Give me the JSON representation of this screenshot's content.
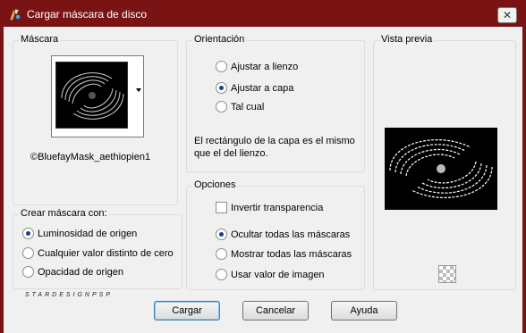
{
  "window": {
    "title": "Cargar máscara de disco",
    "close_glyph": "✕",
    "accent_color": "#7a1414"
  },
  "mask_group": {
    "title": "Máscara",
    "mask_name": "©BluefayMask_aethiopien1",
    "dropdown_icon": "chevron-down-icon"
  },
  "orientation_group": {
    "title": "Orientación",
    "options": [
      {
        "label": "Ajustar a lienzo",
        "selected": false
      },
      {
        "label": "Ajustar a capa",
        "selected": true
      },
      {
        "label": "Tal cual",
        "selected": false
      }
    ],
    "note": "El rectángulo de la capa es el mismo que el del lienzo."
  },
  "preview_group": {
    "title": "Vista previa",
    "toggle_icon": "transparency-checker-icon"
  },
  "create_group": {
    "title": "Crear máscara con:",
    "options": [
      {
        "label": "Luminosidad de origen",
        "selected": true
      },
      {
        "label": "Cualquier valor distinto de cero",
        "selected": false
      },
      {
        "label": "Opacidad de origen",
        "selected": false
      }
    ]
  },
  "options_group": {
    "title": "Opciones",
    "invert_label": "Invertir transparencia",
    "invert_checked": false,
    "options": [
      {
        "label": "Ocultar todas las máscaras",
        "selected": true
      },
      {
        "label": "Mostrar todas las máscaras",
        "selected": false
      },
      {
        "label": "Usar valor de imagen",
        "selected": false
      }
    ]
  },
  "watermark": "STARDESIGNPSP",
  "buttons": {
    "ok": "Cargar",
    "cancel": "Cancelar",
    "help": "Ayuda"
  }
}
